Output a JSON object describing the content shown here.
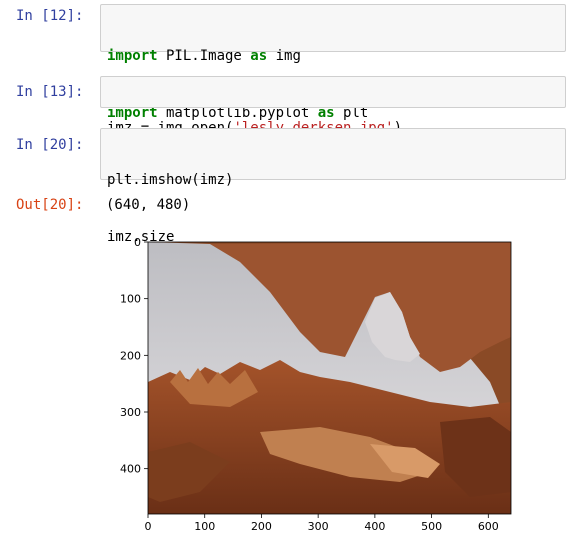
{
  "cells": [
    {
      "prompt": "In [12]:",
      "lines": [
        [
          {
            "t": "import",
            "c": "kw"
          },
          {
            "t": " PIL.Image ",
            "c": ""
          },
          {
            "t": "as",
            "c": "kw"
          },
          {
            "t": " img",
            "c": ""
          }
        ],
        [
          {
            "t": "import",
            "c": "kw"
          },
          {
            "t": " matplotlib.pyplot ",
            "c": ""
          },
          {
            "t": "as",
            "c": "kw"
          },
          {
            "t": " plt",
            "c": ""
          }
        ]
      ]
    },
    {
      "prompt": "In [13]:",
      "lines": [
        [
          {
            "t": "imz = img.open(",
            "c": ""
          },
          {
            "t": "'lesly_derksen.jpg'",
            "c": "str"
          },
          {
            "t": ")",
            "c": ""
          }
        ]
      ]
    },
    {
      "prompt": "In [20]:",
      "lines": [
        [
          {
            "t": "plt.imshow(imz)",
            "c": ""
          }
        ],
        [
          {
            "t": "imz.size",
            "c": ""
          }
        ]
      ]
    }
  ],
  "output": {
    "prompt": "Out[20]:",
    "text": "(640, 480)"
  },
  "plot": {
    "image_file": "lesly_derksen.jpg",
    "x_ticks": [
      "0",
      "100",
      "200",
      "300",
      "400",
      "500",
      "600"
    ],
    "y_ticks": [
      "0",
      "100",
      "200",
      "300",
      "400"
    ],
    "colors": {
      "rock_dark": "#7a3a1a",
      "rock_mid": "#a5552b",
      "rock_light": "#c98a5a",
      "sky": "#cfcfd4",
      "sky_light": "#e6e6ea"
    }
  }
}
